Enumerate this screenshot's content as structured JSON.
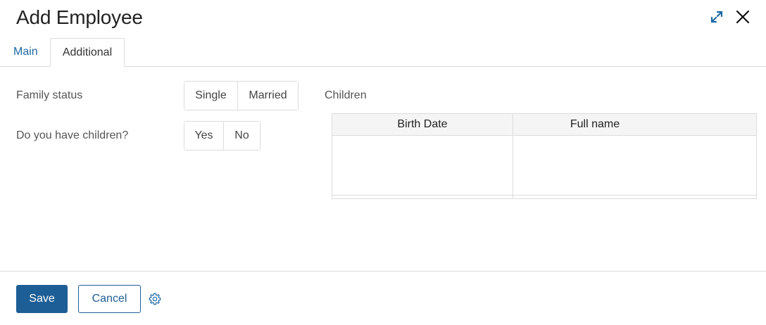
{
  "colors": {
    "accent": "#1d5e96",
    "link": "#1d6aa5",
    "border": "#dcdcdc"
  },
  "header": {
    "title": "Add Employee",
    "expand_icon": "expand-icon",
    "close_icon": "close-icon"
  },
  "tabs": [
    {
      "label": "Main",
      "active": false
    },
    {
      "label": "Additional",
      "active": true
    }
  ],
  "form": {
    "family_status": {
      "label": "Family status",
      "options": [
        "Single",
        "Married"
      ]
    },
    "have_children": {
      "label": "Do you have children?",
      "options": [
        "Yes",
        "No"
      ]
    },
    "children": {
      "label": "Children",
      "columns": [
        "Birth Date",
        "Full name"
      ],
      "rows": []
    }
  },
  "footer": {
    "save_label": "Save",
    "cancel_label": "Cancel",
    "settings_icon": "gear-icon"
  }
}
